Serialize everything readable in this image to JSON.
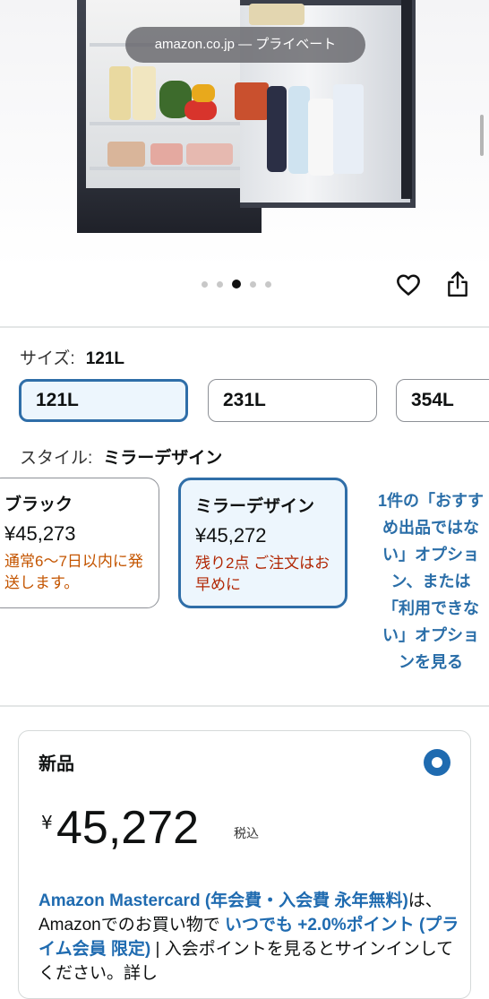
{
  "browser": {
    "url_label": "amazon.co.jp — プライベート"
  },
  "gallery": {
    "dot_count": 5,
    "active_index": 2
  },
  "size": {
    "label": "サイズ:",
    "selected": "121L",
    "options": [
      "121L",
      "231L",
      "354L"
    ]
  },
  "style": {
    "label": "スタイル:",
    "selected": "ミラーデザイン",
    "options": [
      {
        "name": "ブラック",
        "price": "¥45,273",
        "note": "通常6〜7日以内に発送します。"
      },
      {
        "name": "ミラーデザイン",
        "price": "¥45,272",
        "note": "残り2点 ご注文はお早めに"
      }
    ],
    "more_link": "1件の「おすすめ出品ではない」オプション、または「利用できない」オプションを見る"
  },
  "buybox": {
    "title": "新品",
    "currency": "¥",
    "price": "45,272",
    "tax_note": "税込",
    "promo_card": "Amazon Mastercard (年会費・入会費 永年無料)",
    "promo_text1": "は、Amazonでのお買い物で ",
    "promo_bold1": "いつでも +2.0%ポイント (プライム会員 限定)",
    "promo_text2": " | 入会ポイントを見るとサインインしてください。詳し"
  },
  "colors": {
    "accent": "#2f6ea8",
    "selected_bg": "#edf6fd",
    "orange": "#c45500",
    "red": "#b12704"
  }
}
